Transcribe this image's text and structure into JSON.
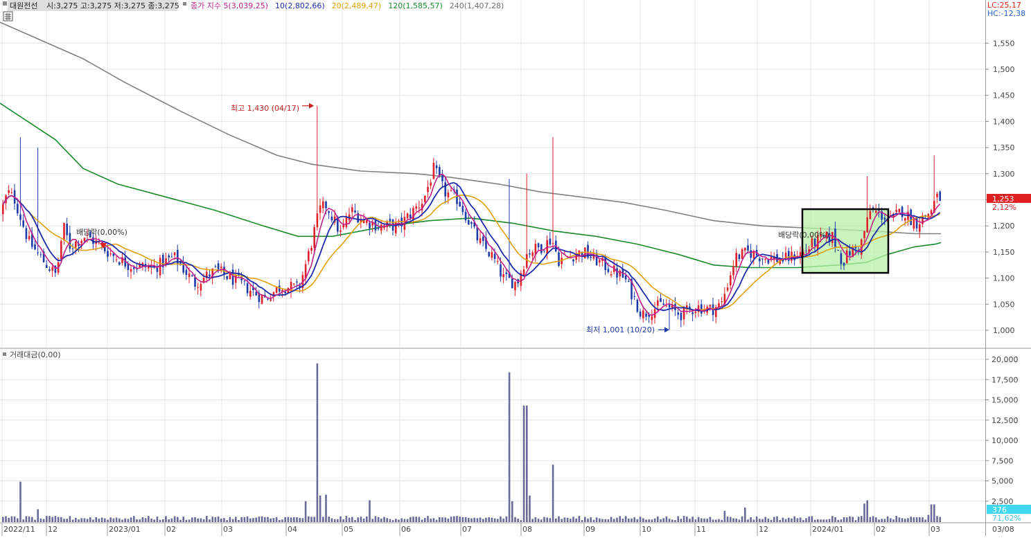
{
  "header": {
    "name": "대원전선",
    "ohlc": "시:3,275 고:3,275 저:3,275 종:3,275",
    "ma_items": [
      {
        "label": "종가 지수 5(3,039,25)",
        "color": "#c0208a"
      },
      {
        "label": "10(2,802,66)",
        "color": "#1c2aa8"
      },
      {
        "label": "20(2,489,47)",
        "color": "#e0a010"
      },
      {
        "label": "120(1,585,57)",
        "color": "#1a8a2a"
      },
      {
        "label": "240(1,407,28)",
        "color": "#707070"
      }
    ],
    "lc": "LC:25,17",
    "hc": "HC:-12,38"
  },
  "volume_header": {
    "label": "거래대금(0,00)"
  },
  "annotations": {
    "high": "최고 1,430 (04/17)",
    "low": "최저 1,001 (10/20)",
    "dividend1": "배당락(0,00%)",
    "dividend2": "배당락(0,00%)"
  },
  "price_tag": {
    "value": "1,253",
    "pct": "2,12%"
  },
  "volume_tag": {
    "value": "376",
    "pct": "71,62%"
  },
  "colors": {
    "up": "#e0202a",
    "down": "#1c3aa8",
    "ma5": "#c0208a",
    "ma10": "#1c2aa8",
    "ma20": "#e0a010",
    "ma120": "#1a8a2a",
    "ma240": "#808080",
    "volume": "#6a6a9a",
    "grid": "#e4e4e4",
    "highlight": "#b8f0a8"
  },
  "chart_data": [
    {
      "type": "candlestick",
      "ylim": [
        975,
        1585
      ],
      "y_ticks": [
        "1,000",
        "1,050",
        "1,100",
        "1,150",
        "1,200",
        "1,250",
        "1,300",
        "1,350",
        "1,400",
        "1,450",
        "1,500",
        "1,550"
      ],
      "x_ticks": [
        "2022/11",
        "12",
        "2023/01",
        "02",
        "03",
        "04",
        "05",
        "06",
        "07",
        "08",
        "09",
        "10",
        "11",
        "12",
        "2024/01",
        "02",
        "03",
        "03/08"
      ],
      "close_anchors": [
        [
          0,
          1225
        ],
        [
          10,
          1265
        ],
        [
          20,
          1250
        ],
        [
          40,
          1170
        ],
        [
          60,
          1135
        ],
        [
          80,
          1105
        ],
        [
          90,
          1200
        ],
        [
          100,
          1160
        ],
        [
          120,
          1180
        ],
        [
          130,
          1175
        ],
        [
          160,
          1145
        ],
        [
          185,
          1125
        ],
        [
          220,
          1120
        ],
        [
          250,
          1140
        ],
        [
          280,
          1090
        ],
        [
          310,
          1115
        ],
        [
          345,
          1090
        ],
        [
          380,
          1060
        ],
        [
          405,
          1085
        ],
        [
          430,
          1080
        ],
        [
          445,
          1150
        ],
        [
          460,
          1230
        ],
        [
          470,
          1240
        ],
        [
          490,
          1185
        ],
        [
          505,
          1230
        ],
        [
          525,
          1210
        ],
        [
          545,
          1200
        ],
        [
          575,
          1200
        ],
        [
          610,
          1250
        ],
        [
          625,
          1310
        ],
        [
          640,
          1265
        ],
        [
          660,
          1250
        ],
        [
          675,
          1210
        ],
        [
          690,
          1170
        ],
        [
          710,
          1140
        ],
        [
          725,
          1100
        ],
        [
          745,
          1090
        ],
        [
          760,
          1150
        ],
        [
          780,
          1160
        ],
        [
          795,
          1175
        ],
        [
          805,
          1135
        ],
        [
          815,
          1140
        ],
        [
          840,
          1150
        ],
        [
          870,
          1125
        ],
        [
          900,
          1100
        ],
        [
          925,
          1030
        ],
        [
          955,
          1050
        ],
        [
          980,
          1030
        ],
        [
          1005,
          1045
        ],
        [
          1025,
          1040
        ],
        [
          1040,
          1050
        ],
        [
          1060,
          1140
        ],
        [
          1080,
          1150
        ],
        [
          1100,
          1140
        ],
        [
          1130,
          1135
        ],
        [
          1160,
          1150
        ],
        [
          1175,
          1170
        ],
        [
          1200,
          1180
        ],
        [
          1215,
          1130
        ],
        [
          1225,
          1150
        ],
        [
          1240,
          1160
        ],
        [
          1255,
          1230
        ],
        [
          1265,
          1225
        ],
        [
          1285,
          1210
        ],
        [
          1300,
          1230
        ],
        [
          1320,
          1205
        ],
        [
          1340,
          1225
        ],
        [
          1350,
          1253
        ]
      ],
      "ma": {
        "ma120": [
          [
            0,
            1435
          ],
          [
            40,
            1400
          ],
          [
            80,
            1365
          ],
          [
            120,
            1310
          ],
          [
            170,
            1280
          ],
          [
            240,
            1255
          ],
          [
            310,
            1230
          ],
          [
            380,
            1200
          ],
          [
            430,
            1180
          ],
          [
            480,
            1180
          ],
          [
            560,
            1200
          ],
          [
            620,
            1210
          ],
          [
            680,
            1215
          ],
          [
            740,
            1205
          ],
          [
            800,
            1190
          ],
          [
            860,
            1180
          ],
          [
            920,
            1165
          ],
          [
            980,
            1145
          ],
          [
            1030,
            1125
          ],
          [
            1080,
            1120
          ],
          [
            1150,
            1120
          ],
          [
            1210,
            1125
          ],
          [
            1250,
            1130
          ],
          [
            1280,
            1145
          ],
          [
            1320,
            1160
          ],
          [
            1350,
            1165
          ],
          [
            1358,
            1168
          ]
        ],
        "ma240": [
          [
            0,
            1590
          ],
          [
            60,
            1555
          ],
          [
            120,
            1520
          ],
          [
            180,
            1475
          ],
          [
            260,
            1420
          ],
          [
            330,
            1375
          ],
          [
            400,
            1335
          ],
          [
            450,
            1318
          ],
          [
            520,
            1305
          ],
          [
            600,
            1300
          ],
          [
            650,
            1293
          ],
          [
            720,
            1280
          ],
          [
            780,
            1265
          ],
          [
            840,
            1255
          ],
          [
            900,
            1245
          ],
          [
            960,
            1230
          ],
          [
            1030,
            1210
          ],
          [
            1100,
            1200
          ],
          [
            1180,
            1195
          ],
          [
            1260,
            1190
          ],
          [
            1320,
            1185
          ],
          [
            1358,
            1185
          ]
        ]
      },
      "events": [
        {
          "name": "high",
          "x": 455,
          "value": 1430
        },
        {
          "name": "low",
          "x": 965,
          "value": 1001
        }
      ],
      "highlight_range": {
        "x0": 1158,
        "x1": 1282,
        "y0": 1232,
        "y1": 1110
      }
    },
    {
      "type": "bar",
      "title": "거래대금(0,00)",
      "ylim": [
        0,
        21000
      ],
      "y_ticks": [
        "2,500",
        "5,000",
        "7,500",
        "10,000",
        "12,500",
        "15,000",
        "17,500",
        "20,000"
      ],
      "spikes": [
        [
          27,
          4900
        ],
        [
          55,
          1500
        ],
        [
          441,
          2500
        ],
        [
          455,
          19500
        ],
        [
          462,
          3200
        ],
        [
          468,
          3300
        ],
        [
          533,
          2600
        ],
        [
          732,
          18400
        ],
        [
          737,
          2500
        ],
        [
          757,
          14300
        ],
        [
          763,
          3200
        ],
        [
          795,
          6000
        ],
        [
          798,
          7000
        ],
        [
          1046,
          1300
        ],
        [
          1075,
          1700
        ],
        [
          1248,
          2200
        ],
        [
          1252,
          2600
        ],
        [
          1345,
          2100
        ],
        [
          1340,
          800
        ]
      ],
      "base_volume": 400
    }
  ]
}
